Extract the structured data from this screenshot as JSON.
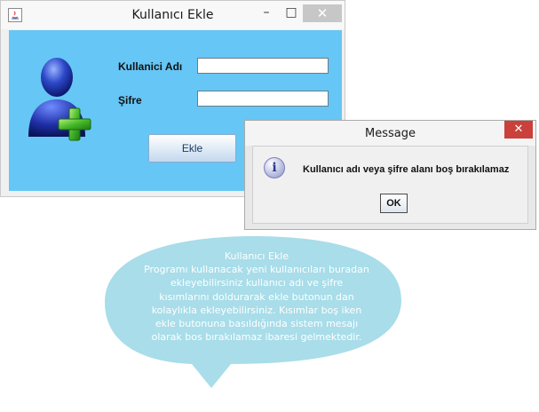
{
  "main_window": {
    "title": "Kullanıcı Ekle",
    "controls": {
      "minimize": "–",
      "maximize": "□",
      "close": "✕"
    },
    "form": {
      "username_label": "Kullanici Adı",
      "username_value": "",
      "password_label": "Şifre",
      "password_value": "",
      "add_button": "Ekle"
    }
  },
  "message_dialog": {
    "title": "Message",
    "close": "✕",
    "icon_glyph": "i",
    "icon": "info-icon",
    "text": "Kullanıcı adı veya şifre alanı boş bırakılamaz",
    "ok_button": "OK"
  },
  "callout": {
    "title": "Kullanıcı Ekle",
    "lines": [
      "Programı kullanacak yeni kullanıcıları buradan",
      "ekleyebilirsiniz  kullanıcı adı ve şifre",
      "kısımlarını doldurarak ekle butonun dan",
      "kolaylıkla ekleyebilirsiniz. Kısımlar boş iken",
      "ekle butonuna basıldığında sistem mesajı",
      "olarak bos bırakılamaz ibaresi gelmektedir."
    ],
    "fill_color": "#a8dde9"
  },
  "colors": {
    "panel_bg": "#66c6f5",
    "close_red": "#c9413a"
  }
}
